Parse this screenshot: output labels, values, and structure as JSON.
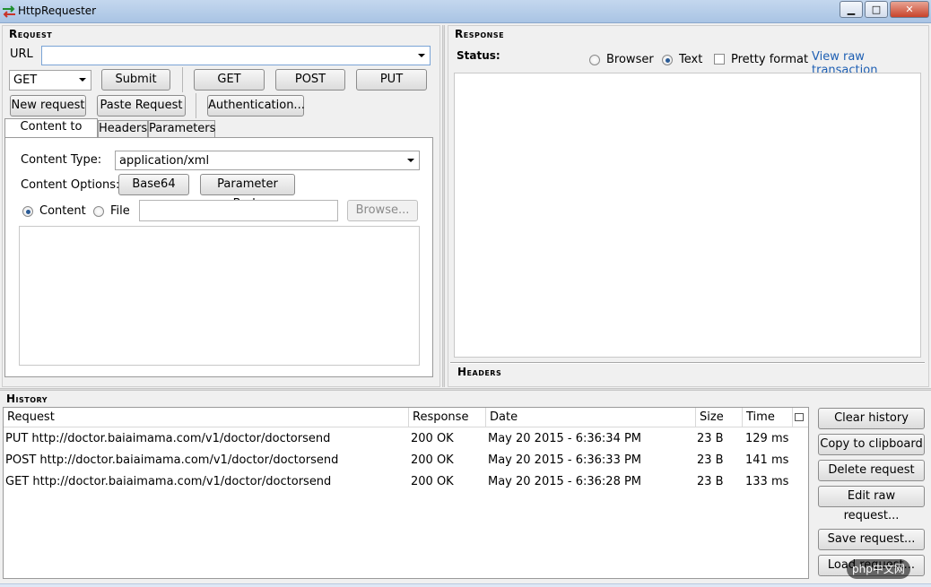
{
  "window": {
    "title": "HttpRequester"
  },
  "request": {
    "section_title": "Request",
    "url_label": "URL",
    "url_value": "",
    "method_selected": "GET",
    "submit_label": "Submit",
    "quick_methods": [
      "GET",
      "POST",
      "PUT"
    ],
    "new_request_label": "New request",
    "paste_request_label": "Paste Request",
    "authentication_label": "Authentication...",
    "tabs": [
      "Content to Send",
      "Headers",
      "Parameters"
    ],
    "content_type_label": "Content Type:",
    "content_type_value": "application/xml",
    "content_options_label": "Content Options:",
    "base64_label": "Base64",
    "parameter_body_label": "Parameter Body",
    "source_content_label": "Content",
    "source_file_label": "File",
    "browse_label": "Browse...",
    "body_text": ""
  },
  "response": {
    "section_title": "Response",
    "status_label": "Status:",
    "view_browser_label": "Browser",
    "view_text_label": "Text",
    "pretty_format_label": "Pretty format",
    "view_raw_label": "View raw transaction",
    "headers_title": "Headers"
  },
  "history": {
    "section_title": "History",
    "columns": [
      "Request",
      "Response",
      "Date",
      "Size",
      "Time"
    ],
    "rows": [
      {
        "request": "PUT http://doctor.baiaimama.com/v1/doctor/doctorsend",
        "response": "200 OK",
        "date": "May 20 2015 - 6:36:34 PM",
        "size": "23 B",
        "time": "129 ms"
      },
      {
        "request": "POST http://doctor.baiaimama.com/v1/doctor/doctorsend",
        "response": "200 OK",
        "date": "May 20 2015 - 6:36:33 PM",
        "size": "23 B",
        "time": "141 ms"
      },
      {
        "request": "GET http://doctor.baiaimama.com/v1/doctor/doctorsend",
        "response": "200 OK",
        "date": "May 20 2015 - 6:36:28 PM",
        "size": "23 B",
        "time": "133 ms"
      }
    ],
    "buttons": {
      "clear_history": "Clear history",
      "copy_to_clipboard": "Copy to clipboard",
      "delete_request": "Delete request",
      "edit_raw_request": "Edit raw request...",
      "save_request": "Save request...",
      "load_request": "Load request..."
    }
  },
  "watermark": "php中文网"
}
